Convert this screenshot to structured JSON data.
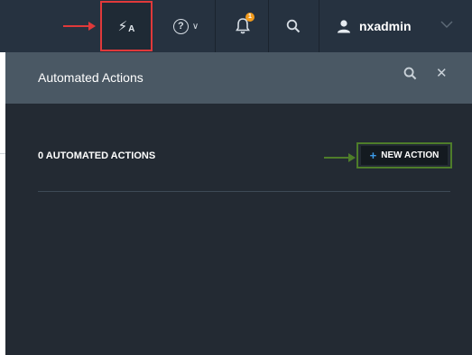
{
  "topbar": {
    "automation_icon_text": "A",
    "help_icon_text": "?",
    "notification_count": "1",
    "username": "nxadmin"
  },
  "panel": {
    "title": "Automated Actions",
    "count_label": "0 AUTOMATED ACTIONS",
    "new_action_label": "NEW ACTION",
    "new_action_plus": "+"
  },
  "icons": {
    "automation": "automation-bolt-icon",
    "help": "help-icon",
    "notifications": "bell-icon",
    "search": "search-icon",
    "user": "user-icon",
    "close": "close-icon"
  },
  "colors": {
    "topbar_bg": "#263240",
    "panel_header_bg": "#4a5864",
    "panel_body_bg": "#232a33",
    "highlight_red": "#e0393a",
    "highlight_green": "#4e7d2a",
    "badge_orange": "#f29b1d",
    "plus_blue": "#3d9be9"
  }
}
